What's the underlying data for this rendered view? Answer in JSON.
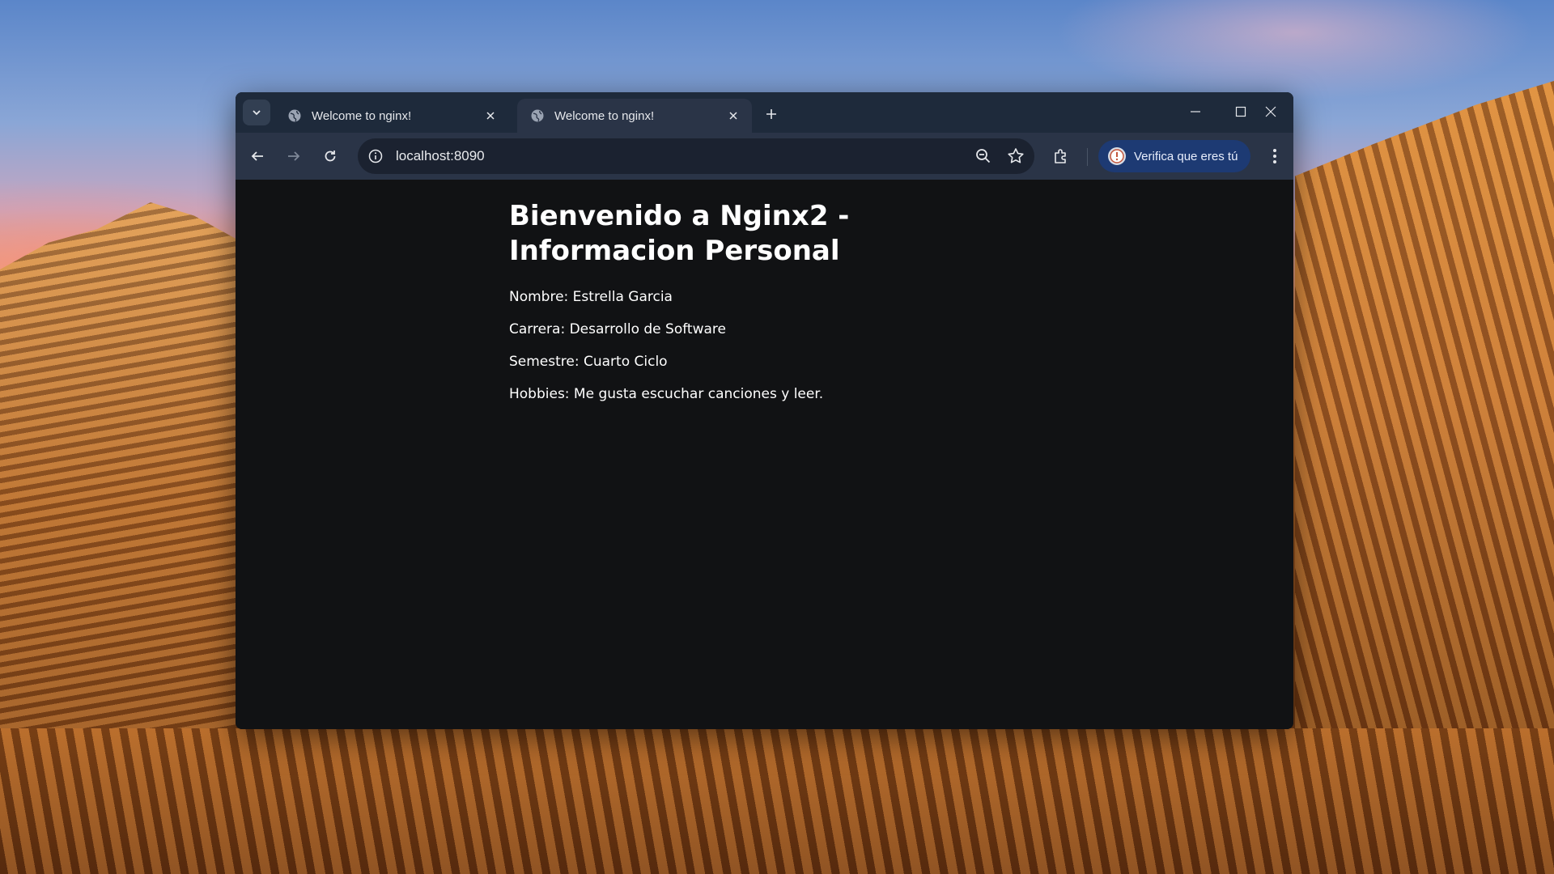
{
  "browser": {
    "tabs": [
      {
        "title": "Welcome to nginx!",
        "active": false
      },
      {
        "title": "Welcome to nginx!",
        "active": true
      }
    ],
    "address": "localhost:8090",
    "profile_label": "Verifica que eres tú"
  },
  "page": {
    "heading": "Bienvenido a Nginx2 - Informacion Personal",
    "lines": [
      "Nombre: Estrella Garcia",
      "Carrera: Desarrollo de Software",
      "Semestre: Cuarto Ciclo",
      "Hobbies: Me gusta escuchar canciones y leer."
    ]
  },
  "colors": {
    "titlebar": "#1e2a3b",
    "toolbar": "#2a3447",
    "page_background": "#111214",
    "profile_chip": "#1d3a73"
  },
  "icons": [
    "tab-search-icon",
    "globe-icon",
    "close-icon",
    "plus-icon",
    "minimize-icon",
    "maximize-icon",
    "back-icon",
    "forward-icon",
    "reload-icon",
    "info-icon",
    "zoom-icon",
    "star-icon",
    "extensions-icon",
    "more-vert-icon"
  ]
}
